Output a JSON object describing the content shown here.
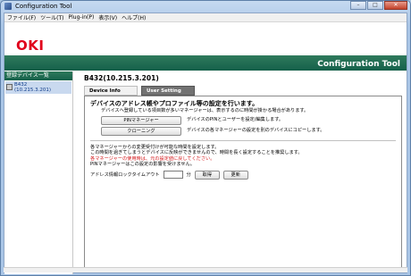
{
  "window": {
    "title": "Configuration Tool"
  },
  "menu": [
    "ファイル(F)",
    "ツール(T)",
    "Plug-in(P)",
    "表示(V)",
    "ヘルプ(H)"
  ],
  "banner": {
    "logo": "OKI",
    "title": "Configuration Tool"
  },
  "sidebar": {
    "header": "登録デバイス一覧",
    "device_name": "B432",
    "device_ip": "(10.215.3.201)"
  },
  "main": {
    "title": "B432(10.215.3.201)",
    "tabs": [
      "Device Info",
      "User Setting"
    ],
    "section_title": "デバイスのアドレス帳やプロファイル等の設定を行います。",
    "section_note": "デバイスへ登録している項目数が多いマネージャーは、表示するのに時間が掛かる場合があります。",
    "pin_button": "PINマネージャー",
    "pin_desc": "デバイスのPINとユーザーを設定/編集します。",
    "clone_button": "クローニング",
    "clone_desc": "デバイスの各マネージャーの設定を別のデバイスにコピーします。",
    "info1": "各マネージャーからの変更受付けが可能な時間を設定します。",
    "info2": "この時間を過ぎてしまうとデバイスに反映ができませんので、時間を長く設定することを推奨します。",
    "warn": "各マネージャーの使用時は、元の設定値に戻してください。",
    "info3": "PINマネージャーはこの設定の影響を受けません。",
    "timeout_label": "アドレス情報ロックタイムアウト",
    "timeout_unit": "分",
    "get_button": "取得",
    "update_button": "更新"
  }
}
